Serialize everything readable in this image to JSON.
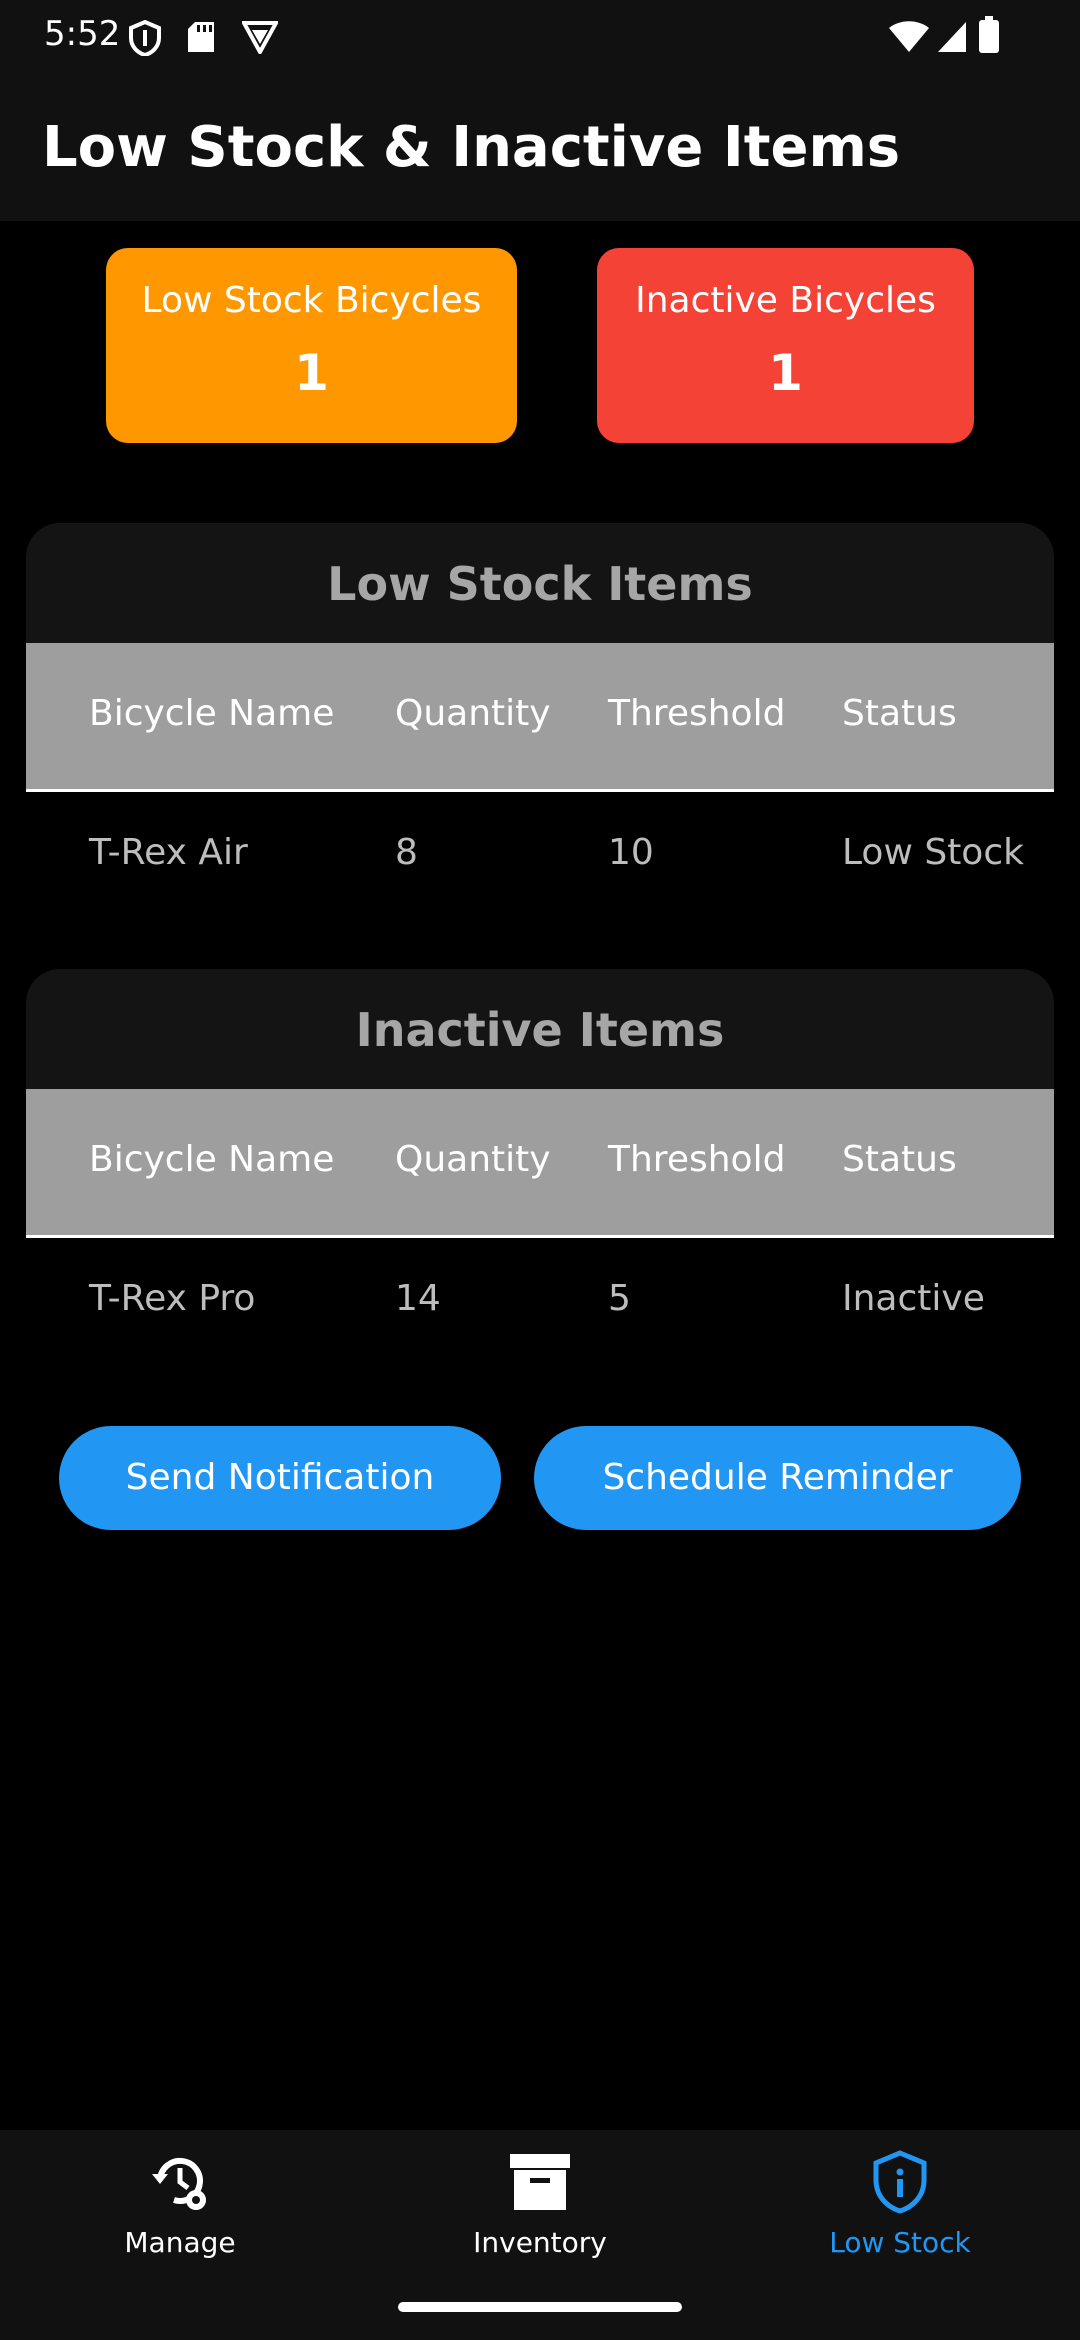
{
  "status_bar": {
    "time": "5:52",
    "left_icons": [
      "shield-icon",
      "sd-card-icon",
      "vpn-icon"
    ],
    "right_icons": [
      "wifi-icon",
      "signal-icon",
      "battery-icon"
    ]
  },
  "app_bar": {
    "title": "Low Stock & Inactive Items"
  },
  "summary": {
    "low_stock": {
      "label": "Low Stock Bicycles",
      "count": "1",
      "color": "#FF9800"
    },
    "inactive": {
      "label": "Inactive Bicycles",
      "count": "1",
      "color": "#F44336"
    }
  },
  "low_stock_table": {
    "title": "Low Stock Items",
    "headers": [
      "Bicycle Name",
      "Quantity",
      "Threshold",
      "Status"
    ],
    "rows": [
      [
        "T-Rex Air",
        "8",
        "10",
        "Low Stock"
      ]
    ]
  },
  "inactive_table": {
    "title": "Inactive Items",
    "headers": [
      "Bicycle Name",
      "Quantity",
      "Threshold",
      "Status"
    ],
    "rows": [
      [
        "T-Rex Pro",
        "14",
        "5",
        "Inactive"
      ]
    ]
  },
  "actions": {
    "send_notification": "Send Notification",
    "schedule_reminder": "Schedule Reminder"
  },
  "bottom_nav": {
    "items": [
      {
        "label": "Manage",
        "icon": "history-settings-icon",
        "active": false
      },
      {
        "label": "Inventory",
        "icon": "archive-box-icon",
        "active": false
      },
      {
        "label": "Low Stock",
        "icon": "shield-info-icon",
        "active": true
      }
    ],
    "active_color": "#2196F3"
  }
}
